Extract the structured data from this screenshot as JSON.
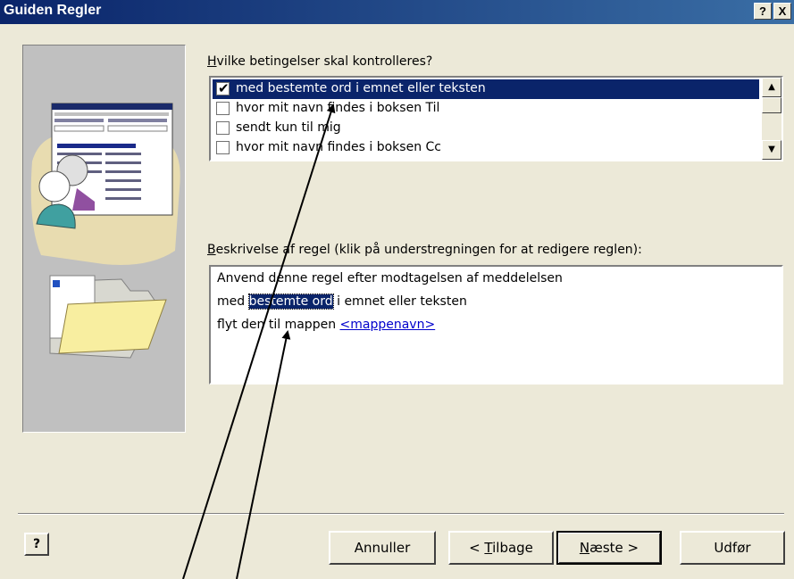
{
  "window": {
    "title": "Guiden Regler",
    "help_button": "?",
    "close_button": "X"
  },
  "conditions": {
    "label": "Hvilke betingelser skal kontrolleres?",
    "label_mnemonic": "H",
    "label_rest": "vilke betingelser skal kontrolleres?",
    "items": [
      {
        "text": "med bestemte ord i emnet eller teksten",
        "checked": true,
        "selected": true
      },
      {
        "text": "hvor mit navn findes i boksen Til",
        "checked": false,
        "selected": false
      },
      {
        "text": "sendt kun til mig",
        "checked": false,
        "selected": false
      },
      {
        "text": "hvor mit navn findes i boksen Cc",
        "checked": false,
        "selected": false
      }
    ]
  },
  "description": {
    "label": "Beskrivelse af regel (klik på understregningen for at redigere reglen):",
    "label_mnemonic": "B",
    "label_rest": "eskrivelse af regel (klik på understregningen for at redigere reglen):",
    "line1": "Anvend denne regel efter modtagelsen af meddelelsen",
    "line2_prefix": "med ",
    "line2_link": "bestemte ord",
    "line2_suffix": " i emnet eller teksten",
    "line3_prefix": "flyt den til mappen ",
    "line3_link": "<mappenavn>"
  },
  "buttons": {
    "help": "?",
    "cancel": "Annuller",
    "back_prefix": "< ",
    "back_mnemonic": "T",
    "back_rest": "ilbage",
    "next_mnemonic": "N",
    "next_rest": "æste >",
    "finish": "Udfør"
  },
  "colors": {
    "title_bar": "#0a246a",
    "selection": "#0a246a",
    "dialog_bg": "#ece9d8",
    "link": "#0000cc"
  }
}
